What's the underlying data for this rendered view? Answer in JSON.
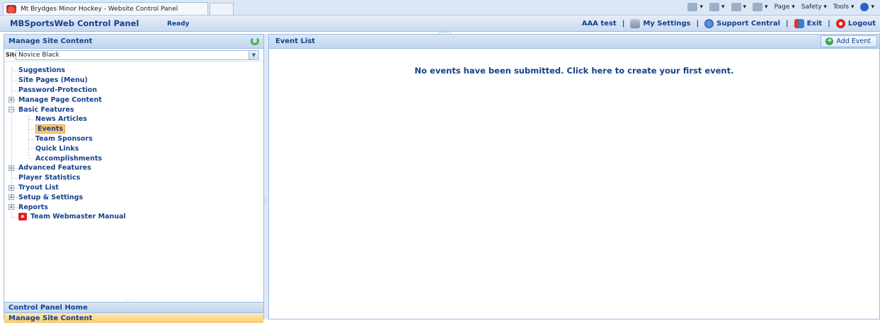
{
  "browser": {
    "tab_title": "Mt Brydges Minor Hockey - Website Control Panel",
    "commands": [
      "Page ▾",
      "Safety ▾",
      "Tools ▾"
    ]
  },
  "header": {
    "app_title": "MBSportsWeb Control Panel",
    "status": "Ready",
    "user": "AAA test",
    "links": {
      "settings": "My Settings",
      "support": "Support Central",
      "exit": "Exit",
      "logout": "Logout"
    }
  },
  "west": {
    "title": "Manage Site Content",
    "site_label": "Site:",
    "site_value": "Novice Black",
    "tree": [
      {
        "label": "Suggestions",
        "level": 0,
        "expandable": false
      },
      {
        "label": "Site Pages (Menu)",
        "level": 0,
        "expandable": false
      },
      {
        "label": "Password-Protection",
        "level": 0,
        "expandable": false
      },
      {
        "label": "Manage Page Content",
        "level": 0,
        "expandable": true
      },
      {
        "label": "Basic Features",
        "level": 0,
        "expandable": true,
        "expanded": true
      },
      {
        "label": "News Articles",
        "level": 1
      },
      {
        "label": "Events",
        "level": 1,
        "selected": true
      },
      {
        "label": "Team Sponsors",
        "level": 1
      },
      {
        "label": "Quick Links",
        "level": 1
      },
      {
        "label": "Accomplishments",
        "level": 1
      },
      {
        "label": "Advanced Features",
        "level": 0,
        "expandable": true
      },
      {
        "label": "Player Statistics",
        "level": 0,
        "expandable": false
      },
      {
        "label": "Tryout List",
        "level": 0,
        "expandable": true
      },
      {
        "label": "Setup & Settings",
        "level": 0,
        "expandable": true
      },
      {
        "label": "Reports",
        "level": 0,
        "expandable": true
      },
      {
        "label": "Team Webmaster Manual",
        "level": 0,
        "expandable": false,
        "pdf": true
      }
    ],
    "accordion": {
      "home": "Control Panel Home",
      "manage": "Manage Site Content"
    }
  },
  "center": {
    "title": "Event List",
    "add_button": "Add Event",
    "empty_message": "No events have been submitted.  Click here to create your first event."
  }
}
